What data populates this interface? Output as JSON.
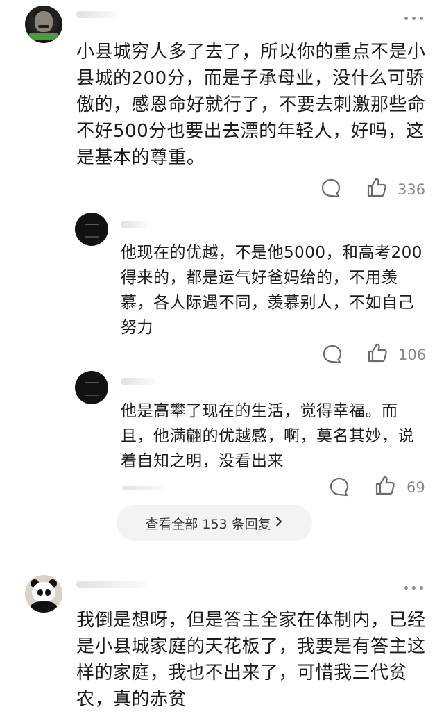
{
  "comments": [
    {
      "avatar": "portrait-avatar",
      "text": "小县城穷人多了去了，所以你的重点不是小县城的200分，而是子承母业，没什么可骄傲的，感恩命好就行了，不要去刺激那些命不好500分也要出去漂的年轻人，好吗，这是基本的尊重。",
      "likes": "336"
    },
    {
      "avatar": "panda-avatar",
      "text": "我倒是想呀，但是答主全家在体制内，已经是小县城家庭的天花板了，我要是有答主这样的家庭，我也不出来了，可惜我三代贫农，真的赤贫"
    }
  ],
  "replies": [
    {
      "avatar": "dark-avatar",
      "text": "他现在的优越，不是他5000，和高考200得来的，都是运气好爸妈给的，不用羡慕，各人际遇不同，羡慕别人，不如自己努力",
      "likes": "106"
    },
    {
      "avatar": "dark-avatar",
      "text": "他是高攀了现在的生活，觉得幸福。而且，他满翩的优越感，啊，莫名其妙，说着自知之明，没看出来",
      "likes": "69"
    }
  ],
  "view_all_replies": {
    "label": "查看全部 153 条回复",
    "icon": "chevron-right-icon"
  },
  "icons": {
    "comment": "comment-bubble-icon",
    "like": "thumbs-up-icon",
    "more": "more-dots-icon"
  },
  "colors": {
    "text": "#1b1b1b",
    "count": "#8a8a8a",
    "pill_bg": "#f3f3f3"
  }
}
